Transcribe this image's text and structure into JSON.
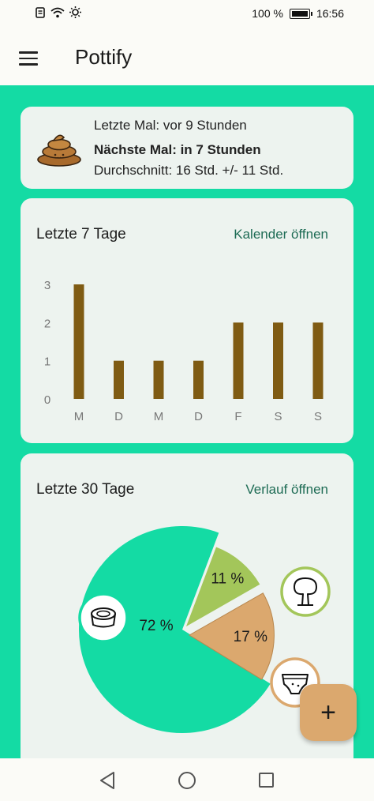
{
  "status_bar": {
    "battery_percent": "100 %",
    "time": "16:56",
    "icons": [
      "notification-icon",
      "wifi-icon",
      "brightness-icon",
      "battery-icon"
    ]
  },
  "app_bar": {
    "title": "Pottify",
    "menu_icon": "hamburger-menu-icon"
  },
  "summary": {
    "last": "Letzte Mal: vor 9 Stunden",
    "next": "Nächste Mal: in 7 Stunden",
    "average": "Durchschnitt: 16 Std. +/- 11 Std.",
    "icon": "poop-icon"
  },
  "week": {
    "title": "Letzte 7 Tage",
    "link": "Kalender öffnen"
  },
  "month": {
    "title": "Letzte 30 Tage",
    "link": "Verlauf öffnen"
  },
  "fab": {
    "label": "+"
  },
  "colors": {
    "background": "#14dba4",
    "card": "#edf3ef",
    "bar": "#7f5b13",
    "pie_potty": "#14dba4",
    "pie_outside": "#a3c65a",
    "pie_diaper": "#dba86e",
    "link": "#1d6b54"
  },
  "chart_data": [
    {
      "type": "bar",
      "categories": [
        "M",
        "D",
        "M",
        "D",
        "F",
        "S",
        "S"
      ],
      "values": [
        3,
        1,
        1,
        1,
        2,
        2,
        2
      ],
      "ylim": [
        0,
        3
      ],
      "yticks": [
        "0",
        "1",
        "2",
        "3"
      ],
      "grid": false,
      "legend": "none"
    },
    {
      "type": "pie",
      "slices": [
        {
          "label": "72 %",
          "value": 72,
          "icon": "potty-icon",
          "color": "#14dba4"
        },
        {
          "label": "11 %",
          "value": 11,
          "icon": "tree-icon",
          "color": "#a3c65a"
        },
        {
          "label": "17 %",
          "value": 17,
          "icon": "diaper-icon",
          "color": "#dba86e"
        }
      ],
      "legend": "none"
    }
  ]
}
